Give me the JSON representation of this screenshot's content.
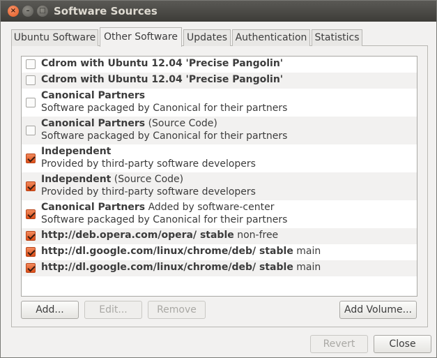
{
  "window": {
    "title": "Software Sources",
    "close_glyph": "×",
    "min_glyph": "–",
    "max_glyph": "□"
  },
  "tabs": [
    {
      "label": "Ubuntu Software",
      "active": false
    },
    {
      "label": "Other Software",
      "active": true
    },
    {
      "label": "Updates",
      "active": false
    },
    {
      "label": "Authentication",
      "active": false
    },
    {
      "label": "Statistics",
      "active": false
    }
  ],
  "sources": [
    {
      "checked": false,
      "title": "Cdrom with Ubuntu 12.04 'Precise Pangolin'",
      "suffix": "",
      "subtitle": ""
    },
    {
      "checked": false,
      "title": "Cdrom with Ubuntu 12.04 'Precise Pangolin'",
      "suffix": "",
      "subtitle": ""
    },
    {
      "checked": false,
      "title": "Canonical Partners",
      "suffix": "",
      "subtitle": "Software packaged by Canonical for their partners"
    },
    {
      "checked": false,
      "title": "Canonical Partners",
      "suffix": " (Source Code)",
      "subtitle": "Software packaged by Canonical for their partners"
    },
    {
      "checked": true,
      "title": "Independent",
      "suffix": "",
      "subtitle": "Provided by third-party software developers"
    },
    {
      "checked": true,
      "title": "Independent",
      "suffix": " (Source Code)",
      "subtitle": "Provided by third-party software developers"
    },
    {
      "checked": true,
      "title": "Canonical Partners",
      "suffix": " Added by software-center",
      "subtitle": "Software packaged by Canonical for their partners"
    },
    {
      "checked": true,
      "title": "http://deb.opera.com/opera/ stable",
      "suffix": " non-free",
      "subtitle": ""
    },
    {
      "checked": true,
      "title": "http://dl.google.com/linux/chrome/deb/ stable",
      "suffix": " main",
      "subtitle": ""
    },
    {
      "checked": true,
      "title": "http://dl.google.com/linux/chrome/deb/ stable",
      "suffix": " main",
      "subtitle": ""
    }
  ],
  "buttons": {
    "add": "Add...",
    "edit": "Edit...",
    "remove": "Remove",
    "add_volume": "Add Volume...",
    "revert": "Revert",
    "close": "Close"
  },
  "colors": {
    "accent_checkbox": "#dd4f19",
    "titlebar": "#3d3c38"
  }
}
